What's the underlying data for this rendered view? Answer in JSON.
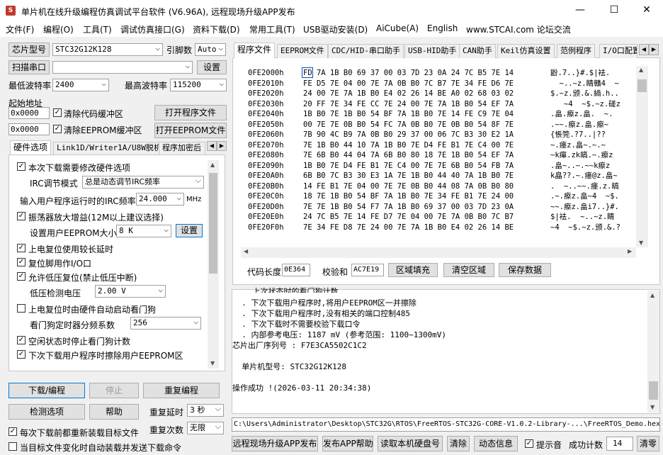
{
  "title": "单片机在线升级编程仿真调试平台软件 (V6.96A), 远程现场升级APP发布",
  "window_controls": {
    "minimize": "—",
    "maximize": "☐",
    "close": "✕"
  },
  "menu": [
    "文件(F)",
    "编程(O)",
    "工具(T)",
    "调试仿真接口(G)",
    "资料下载(D)",
    "常用工具(T)",
    "USB驱动安装(D)",
    "AiCube(A)",
    "English",
    "www.STCAI.com 论坛交流"
  ],
  "left": {
    "chip_model_btn": "芯片型号",
    "chip_model_value": "STC32G12K128",
    "pin_label": "引脚数",
    "pin_value": "Auto",
    "scan_port_btn": "扫描串口",
    "port_value": "",
    "settings_btn": "设置",
    "min_baud_label": "最低波特率",
    "min_baud_value": "2400",
    "max_baud_label": "最高波特率",
    "max_baud_value": "115200",
    "start_addr_label": "起始地址",
    "code_addr": "0x0000",
    "clear_code_label": "清除代码缓冲区",
    "open_prog_btn": "打开程序文件",
    "eeprom_addr": "0x0000",
    "clear_eeprom_label": "清除EEPROM缓冲区",
    "open_eeprom_btn": "打开EEPROM文件",
    "tabs": [
      "硬件选项",
      "Link1D/Writer1A/U8W脱机",
      "程序加密后"
    ],
    "hw": {
      "modify_hw": "本次下载需要修改硬件选项",
      "irc_mode_label": "IRC调节模式",
      "irc_mode_value": "总是动态调节IRC频率",
      "freq_label": "输入用户程序运行时的IRC频率",
      "freq_value": "24.000",
      "freq_unit": "MHz",
      "osc_gain": "振荡器放大增益(12M以上建议选择)",
      "eeprom_size_label": "设置用户EEPROM大小",
      "eeprom_size_value": "8   K",
      "eeprom_set_btn": "设置",
      "reset_delay": "上电复位使用较长延时",
      "reset_pin_io": "复位脚用作I/O口",
      "lvr": "允许低压复位(禁止低压中断)",
      "lvd_label": "低压检测电压",
      "lvd_value": "2.00 V",
      "wdt_hw": "上电复位时由硬件自动启动看门狗",
      "wdt_div_label": "看门狗定时器分频系数",
      "wdt_div_value": "256",
      "idle_wdt": "空闲状态时停止看门狗计数",
      "erase_eeprom": "下次下载用户程序时擦除用户EEPROM区"
    },
    "download_btn": "下载/编程",
    "stop_btn": "停止",
    "reprogram_btn": "重复编程",
    "detect_btn": "检测选项",
    "help_btn": "帮助",
    "retry_delay_label": "重复延时",
    "retry_delay_value": "3 秒",
    "retry_count_label": "重复次数",
    "retry_count_value": "无限",
    "reload_each": "每次下载前都重新装载目标文件",
    "auto_reload": "当目标文件变化时自动装载并发送下载命令"
  },
  "right": {
    "tabs": [
      "程序文件",
      "EEPROM文件",
      "CDC/HID-串口助手",
      "USB-HID助手",
      "CAN助手",
      "Keil仿真设置",
      "范例程序",
      "I/O口配置"
    ],
    "hex_rows": [
      {
        "addr": "0FE2000h",
        "hex": "FD 7A 1B B0 69 37 00 03 7D 23 0A 24 7C B5 7E 14",
        "ascii": "鼢.7..}#.$|袪."
      },
      {
        "addr": "0FE2010h",
        "hex": "FE D5 7E 04 00 7E 7A 0B B0 7C B7 7E 34 FE D6 7E",
        "ascii": "  ~..~z.睛贛4  ~"
      },
      {
        "addr": "0FE2020h",
        "hex": "24 00 7E 7A 1B B0 E4 02 26 14 BE A0 02 68 03 02",
        "ascii": "$.~z.颁.&.緺.h.."
      },
      {
        "addr": "0FE2030h",
        "hex": "20 FF 7E 34 FE CC 7E 24 00 7E 7A 1B B0 54 EF 7A",
        "ascii": "   ~4  ~$.~z.磋z"
      },
      {
        "addr": "0FE2040h",
        "hex": "1B B0 7E 1B B0 54 BF 7A 1B B0 7E 14 FE C9 7E 04",
        "ascii": ".畠.瘵z.畠.  ~."
      },
      {
        "addr": "0FE2050h",
        "hex": "00 7E 7E 0B B0 54 FC 7A 0B B0 7E 0B B0 54 8F 7E",
        "ascii": ".~~.瘵z.畠.瘵~"
      },
      {
        "addr": "0FE2060h",
        "hex": "7B 90 4C B9 7A 0B B0 29 37 00 06 7C B3 30 E2 1A",
        "ascii": "{悵筦.?7..|??"
      },
      {
        "addr": "0FE2070h",
        "hex": "7E 1B B0 44 10 7A 1B B0 7E D4 FE B1 7E C4 00 7E",
        "ascii": "~.瘗z.畠~.~.~"
      },
      {
        "addr": "0FE2080h",
        "hex": "7E 6B B0 44 04 7A 6B B0 80 18 7E 1B B0 54 EF 7A",
        "ascii": "~k癉.zk皜.~.瘵z"
      },
      {
        "addr": "0FE2090h",
        "hex": "1B B0 7E D4 FE B1 7E C4 00 7E 7E 6B B0 54 FB 7A",
        "ascii": ".畠~..~.~~k瘵z"
      },
      {
        "addr": "0FE20A0h",
        "hex": "6B B0 7C B3 30 E3 1A 7E 1B B0 44 40 7A 1B B0 7E",
        "ascii": "k皛??.~.瘗@z.畠~"
      },
      {
        "addr": "0FE20B0h",
        "hex": "14 FE B1 7E 04 00 7E 7E 0B B0 44 08 7A 0B B0 80",
        "ascii": ".  ~..~~.瘗.z.皜"
      },
      {
        "addr": "0FE20C0h",
        "hex": "18 7E 1B B0 54 BF 7A 1B B0 7E 34 FE B1 7E 24 00",
        "ascii": ".~.瘵z.畠~4  ~$."
      },
      {
        "addr": "0FE20D0h",
        "hex": "7E 7E 1B B0 54 F7 7A 1B B0 69 37 00 03 7D 23 0A",
        "ascii": "~~.瘵z.畠i7..}#."
      },
      {
        "addr": "0FE20E0h",
        "hex": "24 7C B5 7E 14 FE D7 7E 04 00 7E 7A 0B B0 7C B7",
        "ascii": "$|袪.  ~..~z.睛"
      },
      {
        "addr": "0FE20F0h",
        "hex": "7E 34 FE D8 7E 24 00 7E 7A 1B B0 E4 02 26 14 BE",
        "ascii": "~4  ~$.~z.颁.&.?"
      }
    ],
    "code_len_label": "代码长度",
    "code_len_value": "0E364",
    "checksum_label": "校验和",
    "checksum_value": "AC7E19",
    "fill_btn": "区域填充",
    "clear_btn": "清空区域",
    "save_btn": "保存数据",
    "log_lines": [
      "  . 下次下载用户程序时,将用户EEPROM区一并擦除",
      "  . 下次下载用户程序时,没有相关的端口控制485",
      "  . 下次下载时不需要校验下载口令",
      "  . 内部参考电压: 1187 mV (参考范围: 1100~1300mV)",
      "芯片出厂序列号 : F7E3CA5502C1C2",
      "",
      "  单片机型号: STC32G12K128",
      "",
      "操作成功 !(2026-03-11 20:34:38)"
    ],
    "log_partial": "  . 上次状态时的看门狗计数",
    "file_path": "C:\\Users\\Administrator\\Desktop\\STC32G\\RTOS\\FreeRTOS-STC32G-CORE-V1.0.2-Library-...\\FreeRTOS_Demo.hex",
    "bottom": {
      "remote_btn": "远程现场升级APP发布",
      "publish_help_btn": "发布APP帮助",
      "read_disk_btn": "读取本机硬盘号",
      "clear_btn": "清除",
      "dynamic_btn": "动态信息",
      "beep_label": "提示音",
      "success_label": "成功计数",
      "success_value": "14",
      "reset_btn": "清零"
    }
  },
  "colors": {
    "accent": "#0078d7",
    "selection": "#3399ff"
  }
}
